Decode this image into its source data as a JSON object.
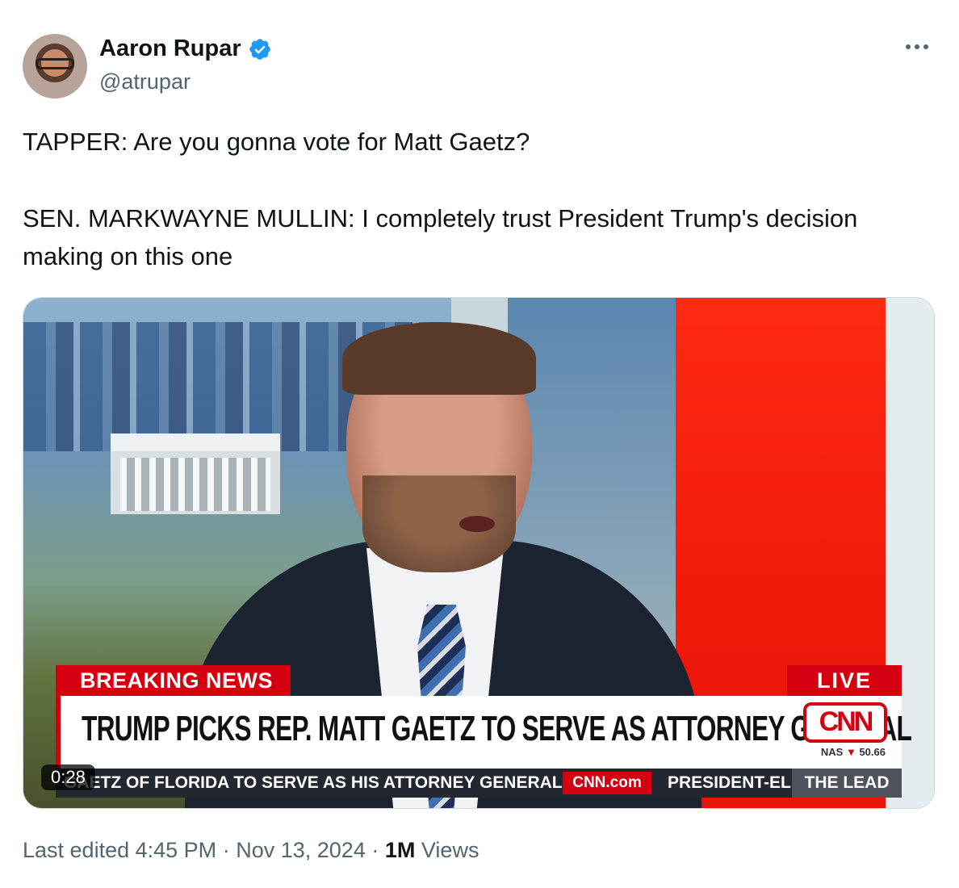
{
  "author": {
    "display_name": "Aaron Rupar",
    "handle": "@atrupar",
    "verified": true,
    "verified_color": "#1d9bf0"
  },
  "more_icon": "more-horizontal-icon",
  "tweet": {
    "line1": "TAPPER: Are you gonna vote for Matt Gaetz?",
    "line2": "SEN. MARKWAYNE MULLIN: I completely trust President Trump's decision making on this one"
  },
  "video": {
    "duration": "0:28",
    "chyron": {
      "breaking_label": "BREAKING NEWS",
      "live_label": "LIVE",
      "headline": "TRUMP PICKS REP. MATT GAETZ TO SERVE AS ATTORNEY GENERAL",
      "logo": "CNN",
      "stock_label": "NAS",
      "stock_arrow": "▼",
      "stock_value": "50.66",
      "ticker_text": "GAETZ OF FLORIDA TO SERVE AS HIS ATTORNEY GENERAL.",
      "ticker_site": "CNN.com",
      "ticker_text2": "PRESIDENT-EL",
      "show_name": "THE LEAD"
    },
    "colors": {
      "cnn_red": "#d4000f"
    }
  },
  "meta": {
    "edited_label": "Last edited",
    "time": "4:45 PM",
    "separator": "·",
    "date": "Nov 13, 2024",
    "views_count": "1M",
    "views_label": "Views"
  }
}
